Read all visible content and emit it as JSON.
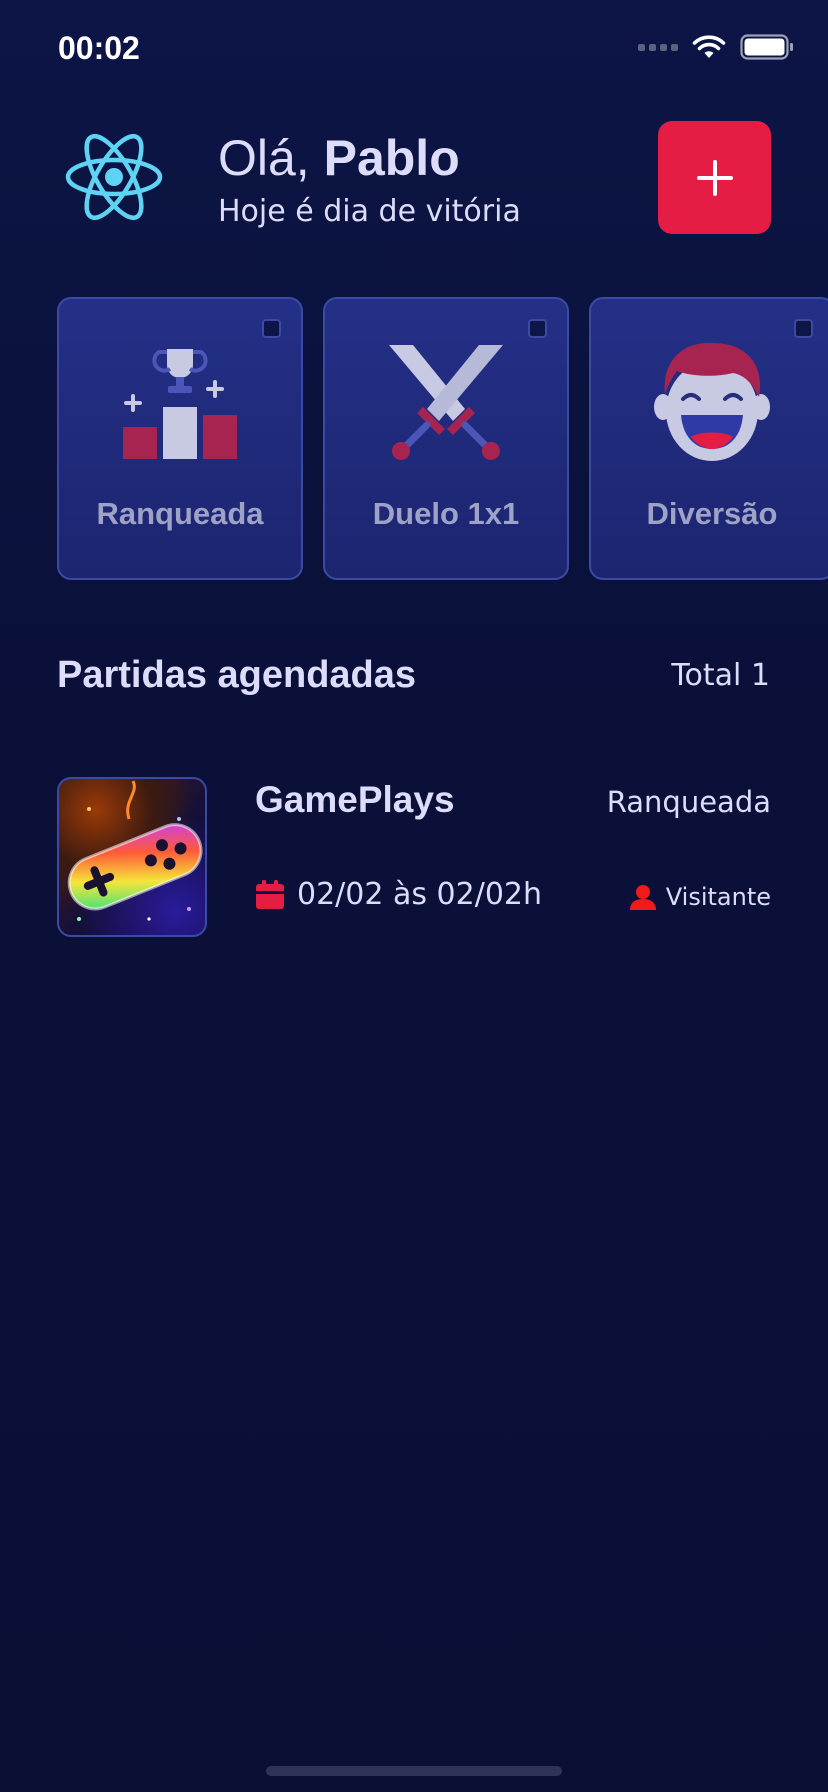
{
  "status_bar": {
    "time": "00:02"
  },
  "header": {
    "greeting_prefix": "Olá,",
    "user_name": "Pablo",
    "subtitle": "Hoje é dia de vitória"
  },
  "categories": [
    {
      "label": "Ranqueada",
      "icon": "podium-trophy-icon"
    },
    {
      "label": "Duelo 1x1",
      "icon": "crossed-swords-icon"
    },
    {
      "label": "Diversão",
      "icon": "laughing-face-icon"
    }
  ],
  "section": {
    "title": "Partidas agendadas",
    "total": "Total 1"
  },
  "matches": [
    {
      "title": "GamePlays",
      "category": "Ranqueada",
      "date": "02/02 às 02/02h",
      "role": "Visitante"
    }
  ],
  "colors": {
    "accent": "#e51c44",
    "background": "#0a1034",
    "card": "#243087",
    "text": "#dddcfa"
  }
}
